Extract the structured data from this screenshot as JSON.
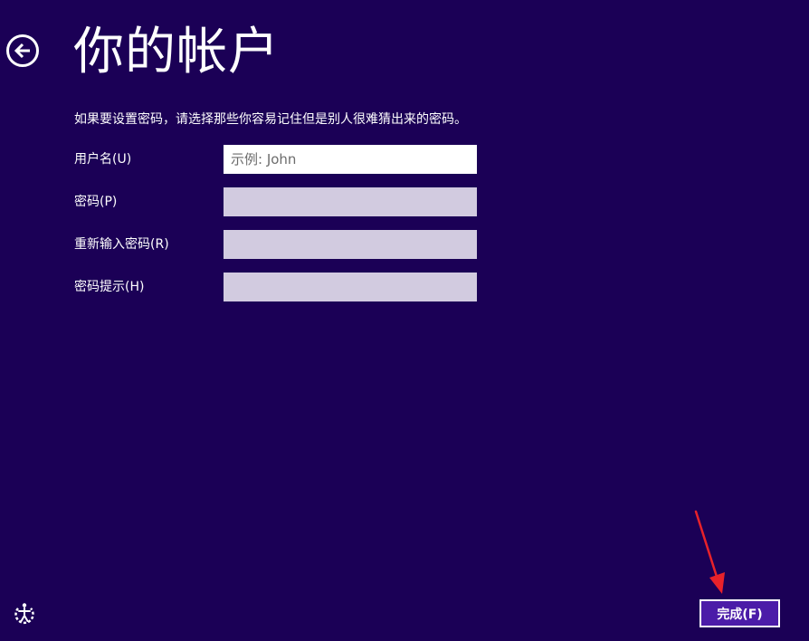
{
  "header": {
    "title": "你的帐户"
  },
  "instructions": "如果要设置密码，请选择那些你容易记住但是别人很难猜出来的密码。",
  "form": {
    "username": {
      "label": "用户名(U)",
      "value": "",
      "placeholder": "示例: John"
    },
    "password": {
      "label": "密码(P)",
      "value": "",
      "placeholder": ""
    },
    "confirm_password": {
      "label": "重新输入密码(R)",
      "value": "",
      "placeholder": ""
    },
    "password_hint": {
      "label": "密码提示(H)",
      "value": "",
      "placeholder": ""
    }
  },
  "footer": {
    "finish_label": "完成(F)"
  },
  "icons": {
    "back": "back-arrow-icon",
    "ease_of_access": "ease-of-access-icon"
  },
  "colors": {
    "background": "#1b0056",
    "button_fill": "#4b1ca8",
    "input_inactive": "#d2cbe0",
    "annotation_arrow": "#e8222a"
  }
}
